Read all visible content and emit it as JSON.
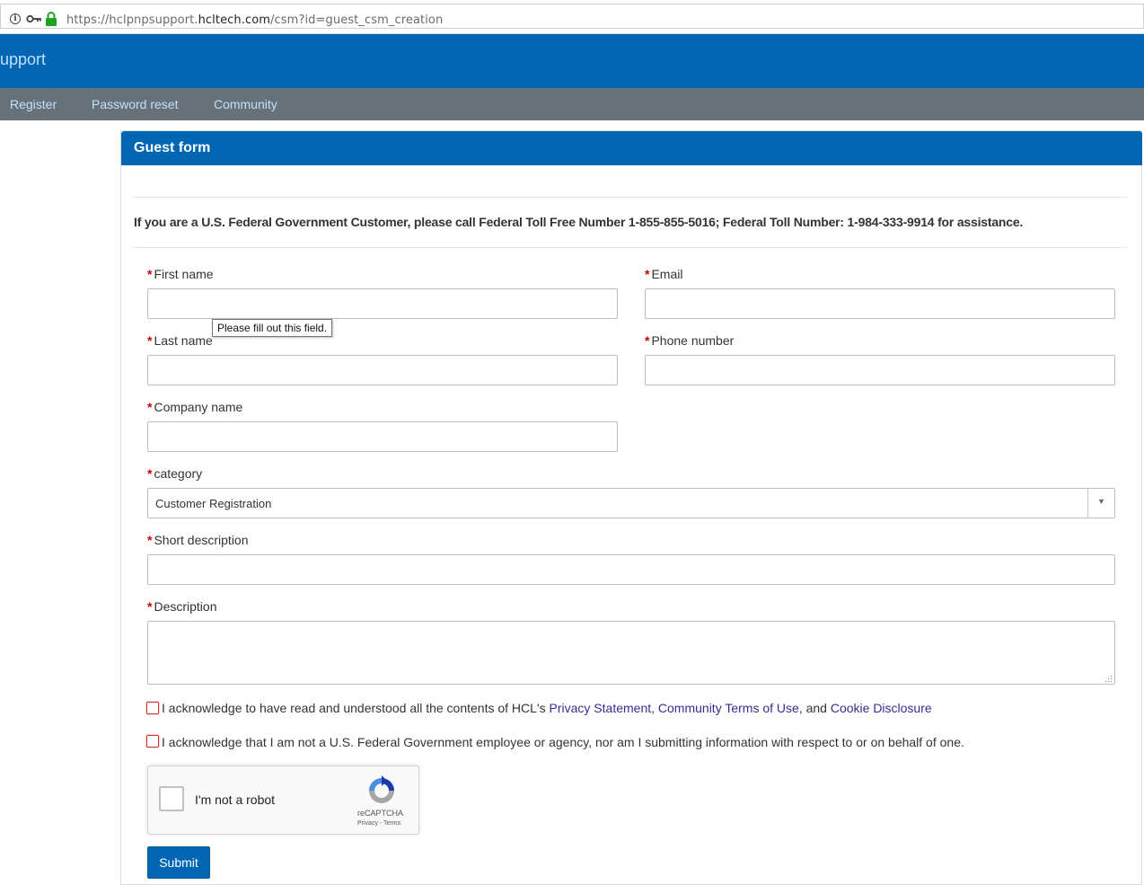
{
  "browser": {
    "url_prefix": "https://hclpnpsupport.",
    "url_domain": "hcltech.com",
    "url_suffix": "/csm?id=guest_csm_creation",
    "info_glyph": "i"
  },
  "header": {
    "title": "upport"
  },
  "nav": {
    "items": [
      "Register",
      "Password reset",
      "Community"
    ]
  },
  "panel": {
    "title": "Guest form"
  },
  "notice": "If you are a U.S. Federal Government Customer, please call Federal Toll Free Number 1-855-855-5016; Federal Toll Number: 1-984-333-9914 for assistance.",
  "form": {
    "required_mark": "*",
    "first_name_label": "First name",
    "email_label": "Email",
    "last_name_label": "Last name",
    "phone_label": "Phone number",
    "company_label": "Company name",
    "category_label": "category",
    "category_value": "Customer Registration",
    "category_arrow": "▼",
    "short_desc_label": "Short description",
    "description_label": "Description",
    "tooltip": "Please fill out this field."
  },
  "ack1": {
    "prefix": "I acknowledge to have read and understood all the contents of HCL's ",
    "privacy": "Privacy Statement",
    "sep1": ", ",
    "terms": "Community Terms of Use",
    "sep2": ", and ",
    "cookie": "Cookie Disclosure"
  },
  "ack2": "I acknowledge that I am not a U.S. Federal Government employee or agency, nor am I submitting information with respect to or on behalf of one.",
  "captcha": {
    "label": "I'm not a robot",
    "brand": "reCAPTCHA",
    "links": "Privacy - Terms"
  },
  "submit_label": "Submit",
  "colors": {
    "brand_blue": "#0066b3",
    "nav_gray": "#687078",
    "link_purple": "#3b2a91",
    "required_red": "#cc0000"
  }
}
